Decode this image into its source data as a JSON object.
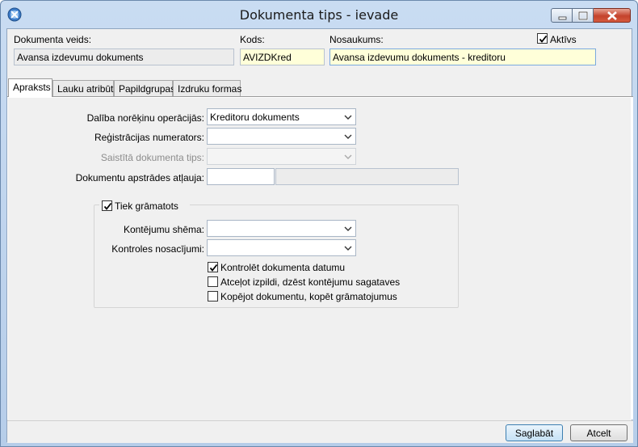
{
  "window": {
    "title": "Dokumenta tips - ievade"
  },
  "header": {
    "doc_type_label": "Dokumenta veids:",
    "doc_type_value": "Avansa izdevumu dokuments",
    "code_label": "Kods:",
    "code_value": "AVIZDKred",
    "name_label": "Nosaukums:",
    "name_value": "Avansa izdevumu dokuments - kreditoru",
    "active_label": "Aktīvs",
    "active_checked": true
  },
  "tabs": [
    {
      "label": "Apraksts",
      "active": true
    },
    {
      "label": "Lauku atribūti",
      "active": false
    },
    {
      "label": "Papildgrupas",
      "active": false
    },
    {
      "label": "Izdruku formas",
      "active": false
    }
  ],
  "form": {
    "settlement_label": "Dalība norēķinu operācijās:",
    "settlement_value": "Kreditoru dokuments",
    "numerator_label": "Reģistrācijas numerators:",
    "numerator_value": "",
    "linked_type_label": "Saistītā dokumenta tips:",
    "linked_type_value": "",
    "permission_label": "Dokumentu apstrādes atļauja:",
    "permission_code": "",
    "permission_name": ""
  },
  "posting": {
    "group_label": "Tiek grāmatots",
    "group_checked": true,
    "scheme_label": "Kontējumu shēma:",
    "scheme_value": "",
    "conditions_label": "Kontroles nosacījumi:",
    "conditions_value": "",
    "options": [
      {
        "label": "Kontrolēt dokumenta datumu",
        "checked": true
      },
      {
        "label": "Atceļot izpildi, dzēst kontējumu sagataves",
        "checked": false
      },
      {
        "label": "Kopējot dokumentu, kopēt grāmatojumus",
        "checked": false
      }
    ]
  },
  "footer": {
    "save_label": "Saglabāt",
    "cancel_label": "Atcelt"
  }
}
